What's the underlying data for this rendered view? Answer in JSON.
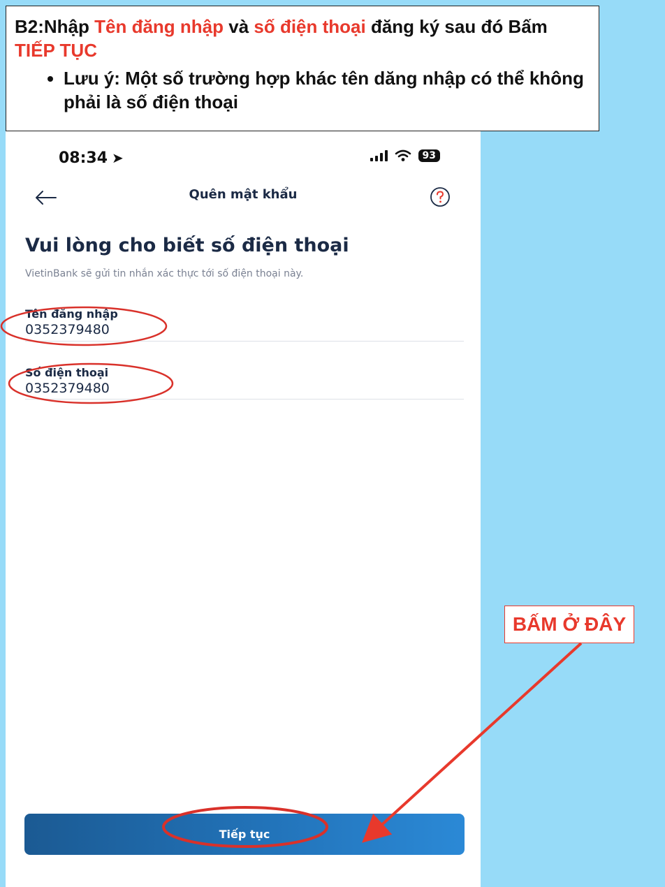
{
  "instruction": {
    "step_prefix": "B2:Nhập ",
    "username_term": "Tên đăng nhập",
    "and_word": " và ",
    "phone_term": "số điện thoại",
    "mid_text": " đăng ký sau đó Bấm ",
    "continue_term": "TIẾP TỤC",
    "note": "Lưu ý: Một số trường hợp khác tên dăng nhập có thể không phải là số điện thoại"
  },
  "status_bar": {
    "time": "08:34",
    "battery": "93"
  },
  "nav": {
    "title": "Quên mật khẩu"
  },
  "content": {
    "headline": "Vui lòng cho biết số điện thoại",
    "subline": "VietinBank sẽ gửi tin nhắn xác thực tới số điện thoại này."
  },
  "fields": [
    {
      "label": "Tên đăng nhập",
      "value": "0352379480"
    },
    {
      "label": "Số điện thoại",
      "value": "0352379480"
    }
  ],
  "cta": {
    "label": "Tiếp tục"
  },
  "callout": {
    "text": "BẤM Ở ĐÂY"
  },
  "colors": {
    "annotation_red": "#e8392c",
    "background_blue": "#97dbf8",
    "navy_text": "#1b2a45",
    "button_blue": "#2273b9"
  },
  "icons": [
    "location-arrow-icon",
    "signal-icon",
    "wifi-icon",
    "battery-icon",
    "back-arrow-icon",
    "help-icon"
  ]
}
